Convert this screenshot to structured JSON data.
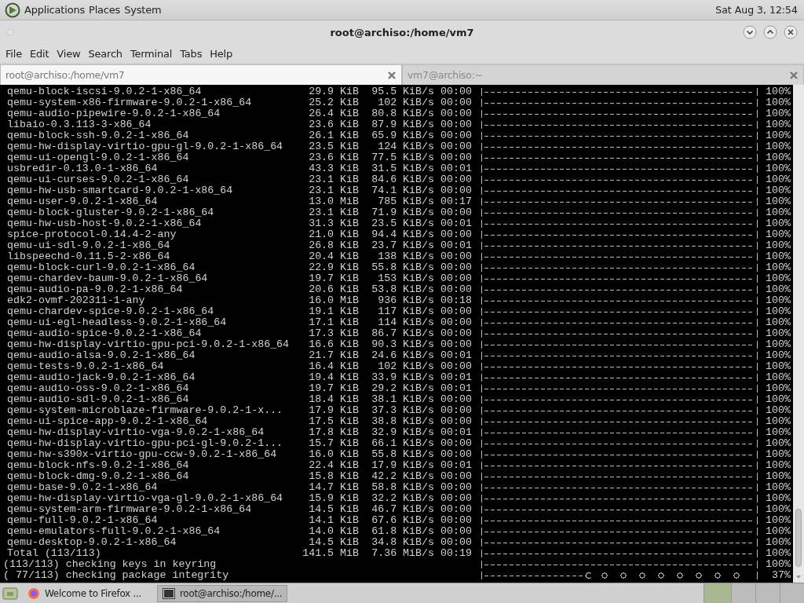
{
  "top_panel": {
    "menus": [
      "Applications",
      "Places",
      "System"
    ],
    "clock": "Sat Aug 3, 12:54"
  },
  "window": {
    "title": "root@archiso:/home/vm7"
  },
  "menu_bar": [
    "File",
    "Edit",
    "View",
    "Search",
    "Terminal",
    "Tabs",
    "Help"
  ],
  "tabs": [
    {
      "label": "root@archiso:/home/vm7",
      "selected": true
    },
    {
      "label": "vm7@archiso:~",
      "selected": false
    }
  ],
  "terminal": {
    "rows": [
      {
        "kind": "package",
        "name": "qemu-block-iscsi-9.0.2-1-x86_64",
        "size": "29.9 KiB",
        "speed": "95.5 KiB/s",
        "time": "00:00",
        "level": 1,
        "percent": "100%"
      },
      {
        "kind": "package",
        "name": "qemu-system-x86-firmware-9.0.2-1-x86_64",
        "size": "25.2 KiB",
        "speed": "102 KiB/s",
        "time": "00:00",
        "level": 1,
        "percent": "100%"
      },
      {
        "kind": "package",
        "name": "qemu-audio-pipewire-9.0.2-1-x86_64",
        "size": "26.4 KiB",
        "speed": "80.8 KiB/s",
        "time": "00:00",
        "level": 1,
        "percent": "100%"
      },
      {
        "kind": "package",
        "name": "libaio-0.3.113-3-x86_64",
        "size": "23.6 KiB",
        "speed": "87.9 KiB/s",
        "time": "00:00",
        "level": 1,
        "percent": "100%"
      },
      {
        "kind": "package",
        "name": "qemu-block-ssh-9.0.2-1-x86_64",
        "size": "26.1 KiB",
        "speed": "65.9 KiB/s",
        "time": "00:00",
        "level": 1,
        "percent": "100%"
      },
      {
        "kind": "package",
        "name": "qemu-hw-display-virtio-gpu-gl-9.0.2-1-x86_64",
        "size": "23.5 KiB",
        "speed": "124 KiB/s",
        "time": "00:00",
        "level": 1,
        "percent": "100%"
      },
      {
        "kind": "package",
        "name": "qemu-ui-opengl-9.0.2-1-x86_64",
        "size": "23.6 KiB",
        "speed": "77.5 KiB/s",
        "time": "00:00",
        "level": 1,
        "percent": "100%"
      },
      {
        "kind": "package",
        "name": "usbredir-0.13.0-1-x86_64",
        "size": "43.3 KiB",
        "speed": "31.5 KiB/s",
        "time": "00:01",
        "level": 1,
        "percent": "100%"
      },
      {
        "kind": "package",
        "name": "qemu-ui-curses-9.0.2-1-x86_64",
        "size": "23.1 KiB",
        "speed": "84.6 KiB/s",
        "time": "00:00",
        "level": 1,
        "percent": "100%"
      },
      {
        "kind": "package",
        "name": "qemu-hw-usb-smartcard-9.0.2-1-x86_64",
        "size": "23.1 KiB",
        "speed": "74.1 KiB/s",
        "time": "00:00",
        "level": 1,
        "percent": "100%"
      },
      {
        "kind": "package",
        "name": "qemu-user-9.0.2-1-x86_64",
        "size": "13.0 MiB",
        "speed": "785 KiB/s",
        "time": "00:17",
        "level": 1,
        "percent": "100%"
      },
      {
        "kind": "package",
        "name": "qemu-block-gluster-9.0.2-1-x86_64",
        "size": "23.1 KiB",
        "speed": "71.9 KiB/s",
        "time": "00:00",
        "level": 1,
        "percent": "100%"
      },
      {
        "kind": "package",
        "name": "qemu-hw-usb-host-9.0.2-1-x86_64",
        "size": "31.3 KiB",
        "speed": "23.5 KiB/s",
        "time": "00:01",
        "level": 1,
        "percent": "100%"
      },
      {
        "kind": "package",
        "name": "spice-protocol-0.14.4-2-any",
        "size": "21.0 KiB",
        "speed": "94.4 KiB/s",
        "time": "00:00",
        "level": 1,
        "percent": "100%"
      },
      {
        "kind": "package",
        "name": "qemu-ui-sdl-9.0.2-1-x86_64",
        "size": "26.8 KiB",
        "speed": "23.7 KiB/s",
        "time": "00:01",
        "level": 1,
        "percent": "100%"
      },
      {
        "kind": "package",
        "name": "libspeechd-0.11.5-2-x86_64",
        "size": "20.4 KiB",
        "speed": "138 KiB/s",
        "time": "00:00",
        "level": 1,
        "percent": "100%"
      },
      {
        "kind": "package",
        "name": "qemu-block-curl-9.0.2-1-x86_64",
        "size": "22.9 KiB",
        "speed": "55.8 KiB/s",
        "time": "00:00",
        "level": 1,
        "percent": "100%"
      },
      {
        "kind": "package",
        "name": "qemu-chardev-baum-9.0.2-1-x86_64",
        "size": "19.7 KiB",
        "speed": "153 KiB/s",
        "time": "00:00",
        "level": 1,
        "percent": "100%"
      },
      {
        "kind": "package",
        "name": "qemu-audio-pa-9.0.2-1-x86_64",
        "size": "20.6 KiB",
        "speed": "53.8 KiB/s",
        "time": "00:00",
        "level": 1,
        "percent": "100%"
      },
      {
        "kind": "package",
        "name": "edk2-ovmf-202311-1-any",
        "size": "16.0 MiB",
        "speed": "936 KiB/s",
        "time": "00:18",
        "level": 1,
        "percent": "100%"
      },
      {
        "kind": "package",
        "name": "qemu-chardev-spice-9.0.2-1-x86_64",
        "size": "19.1 KiB",
        "speed": "117 KiB/s",
        "time": "00:00",
        "level": 1,
        "percent": "100%"
      },
      {
        "kind": "package",
        "name": "qemu-ui-egl-headless-9.0.2-1-x86_64",
        "size": "17.1 KiB",
        "speed": "114 KiB/s",
        "time": "00:00",
        "level": 1,
        "percent": "100%"
      },
      {
        "kind": "package",
        "name": "qemu-audio-spice-9.0.2-1-x86_64",
        "size": "17.3 KiB",
        "speed": "86.7 KiB/s",
        "time": "00:00",
        "level": 1,
        "percent": "100%"
      },
      {
        "kind": "package",
        "name": "qemu-hw-display-virtio-gpu-pci-9.0.2-1-x86_64",
        "size": "16.6 KiB",
        "speed": "90.3 KiB/s",
        "time": "00:00",
        "level": 1,
        "percent": "100%"
      },
      {
        "kind": "package",
        "name": "qemu-audio-alsa-9.0.2-1-x86_64",
        "size": "21.7 KiB",
        "speed": "24.6 KiB/s",
        "time": "00:01",
        "level": 1,
        "percent": "100%"
      },
      {
        "kind": "package",
        "name": "qemu-tests-9.0.2-1-x86_64",
        "size": "16.4 KiB",
        "speed": "102 KiB/s",
        "time": "00:00",
        "level": 1,
        "percent": "100%"
      },
      {
        "kind": "package",
        "name": "qemu-audio-jack-9.0.2-1-x86_64",
        "size": "19.4 KiB",
        "speed": "33.9 KiB/s",
        "time": "00:01",
        "level": 1,
        "percent": "100%"
      },
      {
        "kind": "package",
        "name": "qemu-audio-oss-9.0.2-1-x86_64",
        "size": "19.7 KiB",
        "speed": "29.2 KiB/s",
        "time": "00:01",
        "level": 1,
        "percent": "100%"
      },
      {
        "kind": "package",
        "name": "qemu-audio-sdl-9.0.2-1-x86_64",
        "size": "18.4 KiB",
        "speed": "38.1 KiB/s",
        "time": "00:00",
        "level": 1,
        "percent": "100%"
      },
      {
        "kind": "package",
        "name": "qemu-system-microblaze-firmware-9.0.2-1-x...",
        "size": "17.9 KiB",
        "speed": "37.3 KiB/s",
        "time": "00:00",
        "level": 1,
        "percent": "100%"
      },
      {
        "kind": "package",
        "name": "qemu-ui-spice-app-9.0.2-1-x86_64",
        "size": "17.5 KiB",
        "speed": "38.8 KiB/s",
        "time": "00:00",
        "level": 1,
        "percent": "100%"
      },
      {
        "kind": "package",
        "name": "qemu-hw-display-virtio-vga-9.0.2-1-x86_64",
        "size": "17.8 KiB",
        "speed": "32.9 KiB/s",
        "time": "00:01",
        "level": 1,
        "percent": "100%"
      },
      {
        "kind": "package",
        "name": "qemu-hw-display-virtio-gpu-pci-gl-9.0.2-1...",
        "size": "15.7 KiB",
        "speed": "66.1 KiB/s",
        "time": "00:00",
        "level": 1,
        "percent": "100%"
      },
      {
        "kind": "package",
        "name": "qemu-hw-s390x-virtio-gpu-ccw-9.0.2-1-x86_64",
        "size": "16.0 KiB",
        "speed": "55.8 KiB/s",
        "time": "00:00",
        "level": 1,
        "percent": "100%"
      },
      {
        "kind": "package",
        "name": "qemu-block-nfs-9.0.2-1-x86_64",
        "size": "22.4 KiB",
        "speed": "17.9 KiB/s",
        "time": "00:01",
        "level": 1,
        "percent": "100%"
      },
      {
        "kind": "package",
        "name": "qemu-block-dmg-9.0.2-1-x86_64",
        "size": "15.8 KiB",
        "speed": "42.2 KiB/s",
        "time": "00:00",
        "level": 1,
        "percent": "100%"
      },
      {
        "kind": "package",
        "name": "qemu-base-9.0.2-1-x86_64",
        "size": "14.7 KiB",
        "speed": "58.8 KiB/s",
        "time": "00:00",
        "level": 1,
        "percent": "100%"
      },
      {
        "kind": "package",
        "name": "qemu-hw-display-virtio-vga-gl-9.0.2-1-x86_64",
        "size": "15.9 KiB",
        "speed": "32.2 KiB/s",
        "time": "00:00",
        "level": 1,
        "percent": "100%"
      },
      {
        "kind": "package",
        "name": "qemu-system-arm-firmware-9.0.2-1-x86_64",
        "size": "14.5 KiB",
        "speed": "46.7 KiB/s",
        "time": "00:00",
        "level": 1,
        "percent": "100%"
      },
      {
        "kind": "package",
        "name": "qemu-full-9.0.2-1-x86_64",
        "size": "14.1 KiB",
        "speed": "67.6 KiB/s",
        "time": "00:00",
        "level": 1,
        "percent": "100%"
      },
      {
        "kind": "package",
        "name": "qemu-emulators-full-9.0.2-1-x86_64",
        "size": "14.0 KiB",
        "speed": "61.8 KiB/s",
        "time": "00:00",
        "level": 1,
        "percent": "100%"
      },
      {
        "kind": "package",
        "name": "qemu-desktop-9.0.2-1-x86_64",
        "size": "14.5 KiB",
        "speed": "34.8 KiB/s",
        "time": "00:00",
        "level": 1,
        "percent": "100%"
      },
      {
        "kind": "package",
        "name": "Total (113/113)",
        "size": "141.5 MiB",
        "speed": "7.36 MiB/s",
        "time": "00:19",
        "level": 1,
        "percent": "100%"
      },
      {
        "kind": "status",
        "text": "(113/113) checking keys in keyring",
        "level": 1,
        "percent": "100%"
      },
      {
        "kind": "status",
        "text": "( 77/113) checking package integrity",
        "level": 0.37,
        "percent": "37%"
      }
    ]
  },
  "taskbar": {
    "tasks": [
      {
        "label": "Welcome to Firefox ...",
        "kind": "browser",
        "selected": false
      },
      {
        "label": "root@archiso:/home/...",
        "kind": "terminal",
        "selected": true
      }
    ]
  }
}
